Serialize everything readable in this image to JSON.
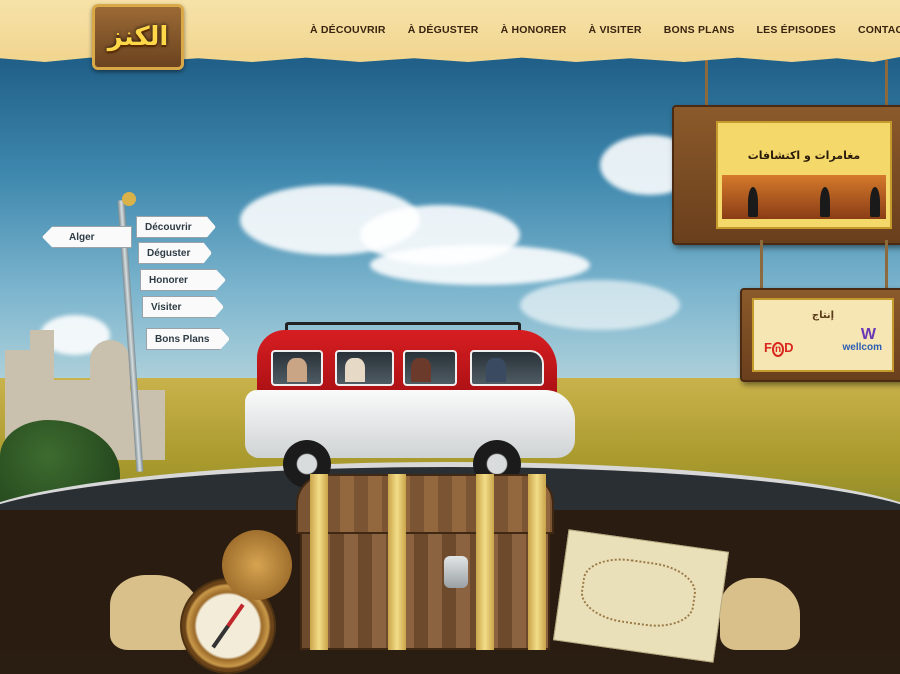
{
  "logo": {
    "text": "الكنز"
  },
  "nav": {
    "items": [
      {
        "label": "À DÉCOUVRIR"
      },
      {
        "label": "À DÉGUSTER"
      },
      {
        "label": "À HONORER"
      },
      {
        "label": "À VISITER"
      },
      {
        "label": "BONS PLANS"
      },
      {
        "label": "LES ÉPISODES"
      },
      {
        "label": "CONTACT"
      }
    ]
  },
  "signpost": {
    "left_sign": "Alger",
    "right_signs": [
      "Découvrir",
      "Déguster",
      "Honorer",
      "Visiter",
      "Bons Plans"
    ]
  },
  "poster": {
    "title": "مغامرات و اكتشافات"
  },
  "production": {
    "label": "إنتاج",
    "found_logo_prefix": "F",
    "found_logo_n": "n",
    "found_logo_suffix": "D",
    "wellcom_logo_mark": "W",
    "wellcom_logo_text": "wellcom"
  },
  "colors": {
    "nav_bar": "#f1d58f",
    "nav_text": "#3a2410",
    "van_red": "#d71e22",
    "sky": "#3f88ae"
  }
}
